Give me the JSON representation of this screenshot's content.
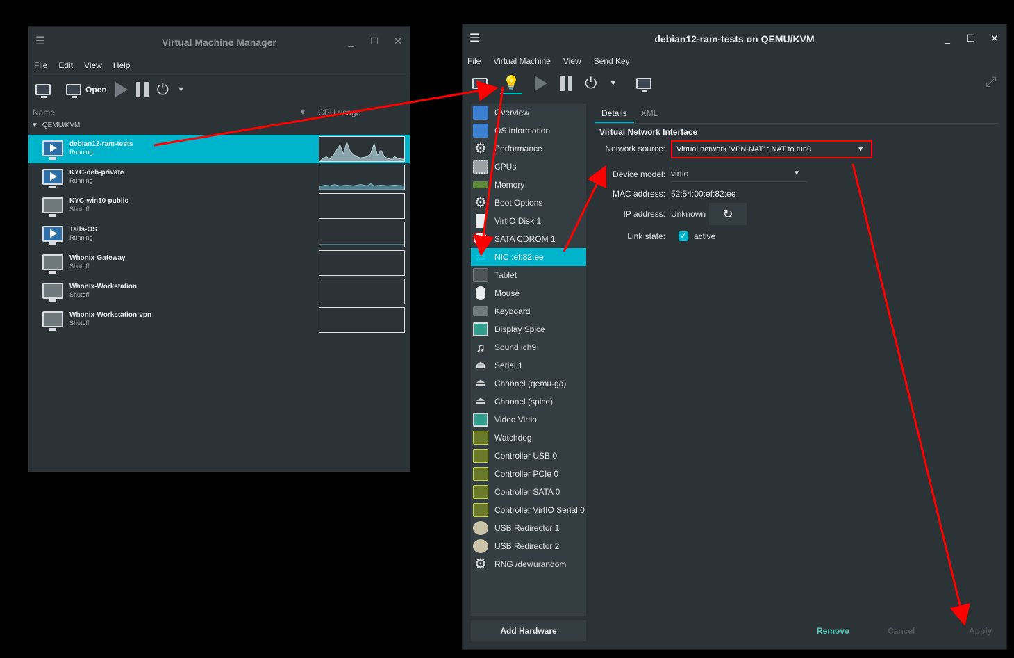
{
  "vmm": {
    "title": "Virtual Machine Manager",
    "menu": [
      "File",
      "Edit",
      "View",
      "Help"
    ],
    "toolbar": {
      "open_label": "Open"
    },
    "columns": {
      "name": "Name",
      "cpu": "CPU usage"
    },
    "group": "QEMU/KVM",
    "vms": [
      {
        "name": "debian12-ram-tests",
        "state": "Running"
      },
      {
        "name": "KYC-deb-private",
        "state": "Running"
      },
      {
        "name": "KYC-win10-public",
        "state": "Shutoff"
      },
      {
        "name": "Tails-OS",
        "state": "Running"
      },
      {
        "name": "Whonix-Gateway",
        "state": "Shutoff"
      },
      {
        "name": "Whonix-Workstation",
        "state": "Shutoff"
      },
      {
        "name": "Whonix-Workstation-vpn",
        "state": "Shutoff"
      }
    ]
  },
  "details": {
    "title": "debian12-ram-tests on QEMU/KVM",
    "menu": [
      "File",
      "Virtual Machine",
      "View",
      "Send Key"
    ],
    "sidebar": [
      "Overview",
      "OS information",
      "Performance",
      "CPUs",
      "Memory",
      "Boot Options",
      "VirtIO Disk 1",
      "SATA CDROM 1",
      "NIC :ef:82:ee",
      "Tablet",
      "Mouse",
      "Keyboard",
      "Display Spice",
      "Sound ich9",
      "Serial 1",
      "Channel (qemu-ga)",
      "Channel (spice)",
      "Video Virtio",
      "Watchdog",
      "Controller USB 0",
      "Controller PCIe 0",
      "Controller SATA 0",
      "Controller VirtIO Serial 0",
      "USB Redirector 1",
      "USB Redirector 2",
      "RNG /dev/urandom"
    ],
    "add_hardware": "Add Hardware",
    "tabs": [
      "Details",
      "XML"
    ],
    "section_title": "Virtual Network Interface",
    "network_source_label": "Network source:",
    "network_source_value": "Virtual network 'VPN-NAT' : NAT to tun0",
    "device_model_label": "Device model:",
    "device_model_value": "virtio",
    "mac_label": "MAC address:",
    "mac_value": "52:54:00:ef:82:ee",
    "ip_label": "IP address:",
    "ip_value": "Unknown",
    "link_label": "Link state:",
    "link_value": "active",
    "buttons": {
      "remove": "Remove",
      "cancel": "Cancel",
      "apply": "Apply"
    }
  },
  "colors": {
    "accent": "#00b4cc",
    "annotation": "#ff0000",
    "window_bg": "#2b3337"
  }
}
